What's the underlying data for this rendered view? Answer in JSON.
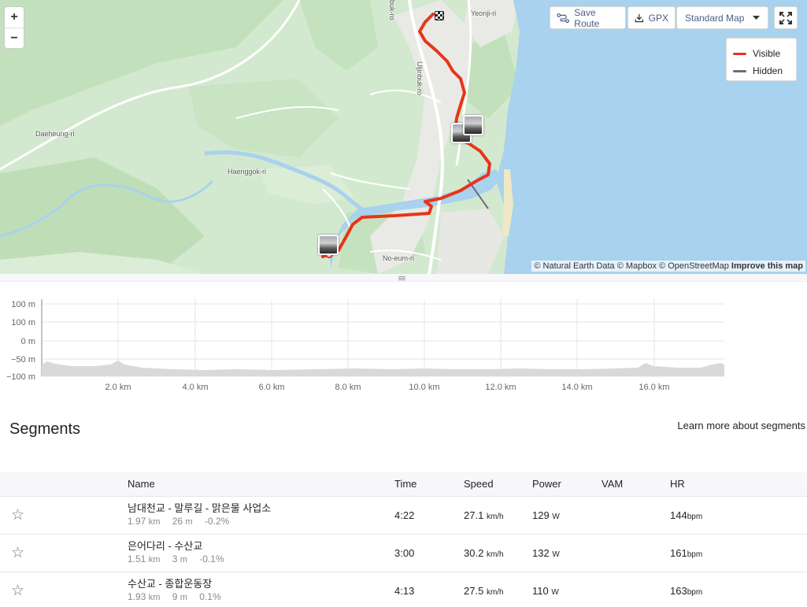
{
  "map": {
    "zoom_in": "+",
    "zoom_out": "−",
    "labels": {
      "daeheung": "Daeheung-ri",
      "haenggok": "Haenggok-ri",
      "yeonji": "Yeonji-ri",
      "noeum": "No-eum-ri",
      "uljinbuk": "Uljinbuk-ro",
      "buk_ro": "buk-ro"
    },
    "toolbar": {
      "save_route": "Save Route",
      "gpx": "GPX",
      "map_style": "Standard Map"
    },
    "legend": {
      "visible": "Visible",
      "hidden": "Hidden",
      "visible_color": "#e8341c",
      "hidden_color": "#6d6d78"
    },
    "attribution": {
      "text": "© Natural Earth Data © Mapbox © OpenStreetMap",
      "improve": "Improve this map"
    },
    "route_color": "#e8341c"
  },
  "elevation": {
    "y_ticks": [
      "100 m",
      "100 m",
      "0 m",
      "−50 m",
      "−100 m"
    ],
    "x_ticks": [
      "2.0 km",
      "4.0 km",
      "6.0 km",
      "8.0 km",
      "10.0 km",
      "12.0 km",
      "14.0 km",
      "16.0 km"
    ]
  },
  "segments": {
    "title": "Segments",
    "learn_more": "Learn more about segments",
    "columns": {
      "name": "Name",
      "time": "Time",
      "speed": "Speed",
      "power": "Power",
      "vam": "VAM",
      "hr": "HR"
    },
    "star_icon": "☆",
    "rows": [
      {
        "name": "남대천교 - 말루길 - 맑은물 사업소",
        "distance": "1.97",
        "distance_unit": "km",
        "elevation": "26",
        "elevation_unit": "m",
        "grade": "-0.2%",
        "time": "4:22",
        "speed": "27.1",
        "speed_unit": "km/h",
        "power": "129",
        "power_unit": "W",
        "vam": "",
        "hr": "144",
        "hr_unit": "bpm"
      },
      {
        "name": "은어다리 - 수산교",
        "distance": "1.51",
        "distance_unit": "km",
        "elevation": "3",
        "elevation_unit": "m",
        "grade": "-0.1%",
        "time": "3:00",
        "speed": "30.2",
        "speed_unit": "km/h",
        "power": "132",
        "power_unit": "W",
        "vam": "",
        "hr": "161",
        "hr_unit": "bpm"
      },
      {
        "name": "수산교 - 종합운동장",
        "distance": "1.93",
        "distance_unit": "km",
        "elevation": "9",
        "elevation_unit": "m",
        "grade": "0.1%",
        "time": "4:13",
        "speed": "27.5",
        "speed_unit": "km/h",
        "power": "110",
        "power_unit": "W",
        "vam": "",
        "hr": "163",
        "hr_unit": "bpm"
      }
    ]
  }
}
